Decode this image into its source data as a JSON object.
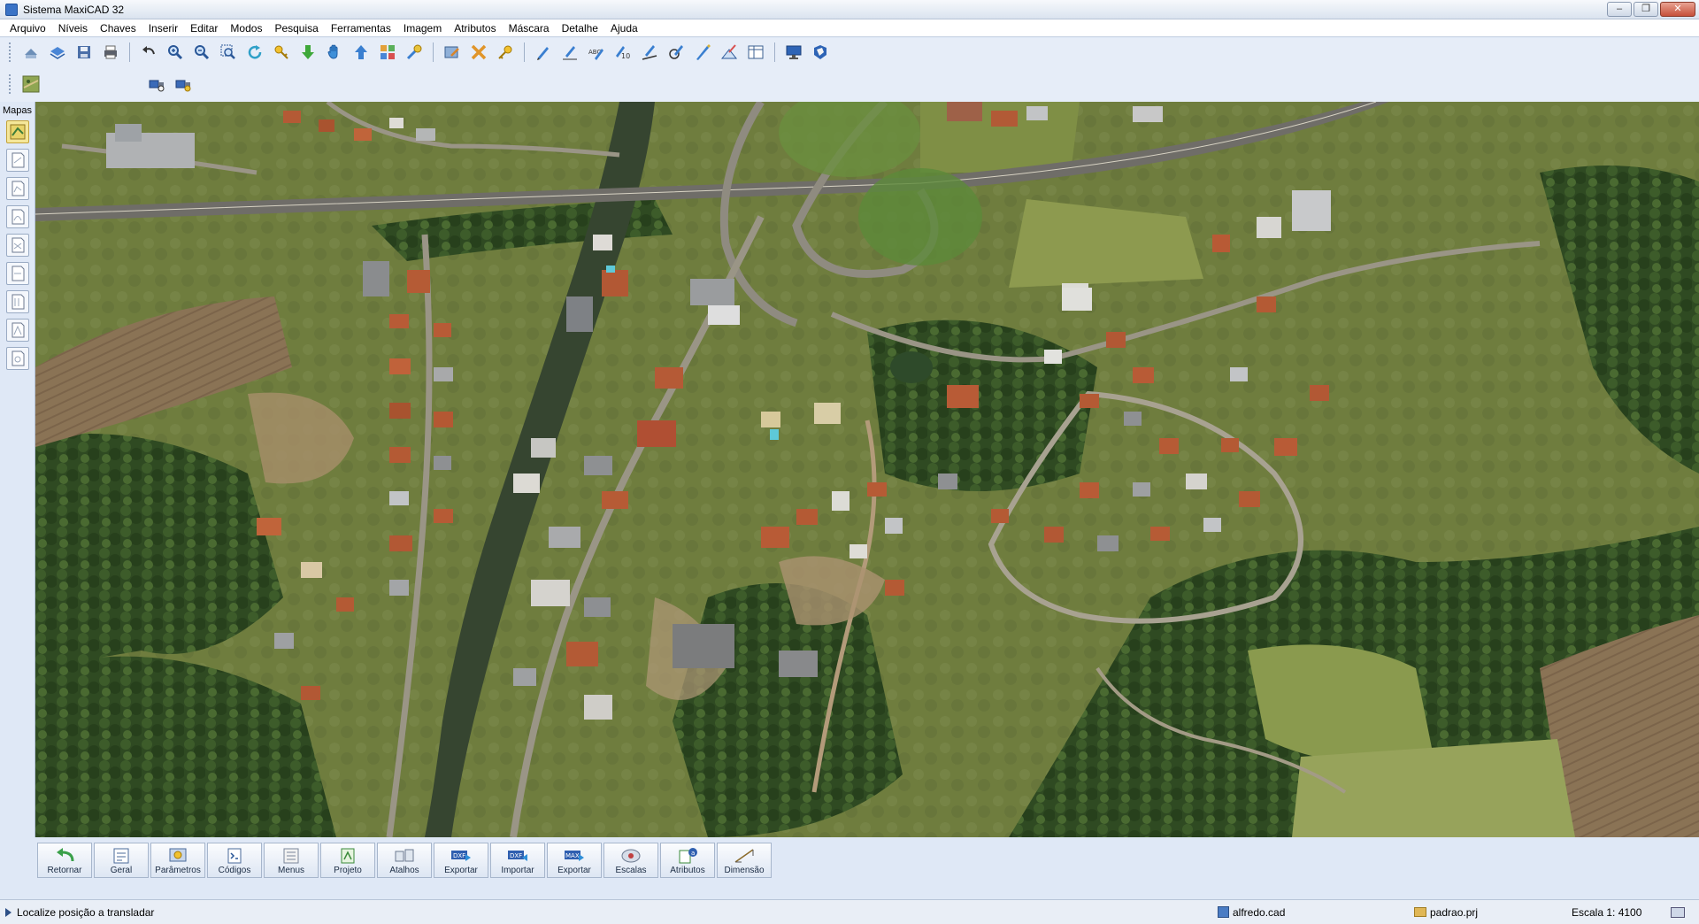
{
  "window": {
    "title": "Sistema MaxiCAD 32"
  },
  "menu": [
    "Arquivo",
    "Níveis",
    "Chaves",
    "Inserir",
    "Editar",
    "Modos",
    "Pesquisa",
    "Ferramentas",
    "Imagem",
    "Atributos",
    "Máscara",
    "Detalhe",
    "Ajuda"
  ],
  "toolbar": {
    "row1_groups": [
      [
        "import-icon",
        "layers-icon",
        "save-icon",
        "print-icon"
      ],
      [
        "undo-icon",
        "zoom-in-icon",
        "zoom-out-icon",
        "zoom-window-icon",
        "regenerate-icon",
        "pan-key-icon",
        "arrow-down-icon",
        "hand-icon",
        "arrow-up-icon",
        "grid-icon",
        "tool-icon"
      ],
      [
        "edit-map-icon",
        "delete-icon",
        "key-icon"
      ],
      [
        "pencil-icon",
        "pencil-text-icon",
        "pencil-abc-icon",
        "pencil-number-icon",
        "pencil-line-icon",
        "pencil-circle-icon",
        "pen-icon",
        "measure-area-icon",
        "table-icon"
      ],
      [
        "monitor-icon",
        "world-icon"
      ]
    ],
    "row2_left": [
      "map-thumbnail-icon"
    ],
    "row2_right": [
      "satellite-icon",
      "satellite-settings-icon"
    ]
  },
  "left_panel": {
    "label": "Mapas",
    "tools": [
      "map-view-icon",
      "map-page-1-icon",
      "map-page-2-icon",
      "map-page-3-icon",
      "map-page-4-icon",
      "map-page-5-icon",
      "map-page-6-icon",
      "map-page-7-icon",
      "map-page-8-icon"
    ]
  },
  "bottom_buttons": [
    {
      "label": "Retornar",
      "icon": "return-arrow-icon"
    },
    {
      "label": "Geral",
      "icon": "general-icon"
    },
    {
      "label": "Parâmetros",
      "icon": "parameters-icon"
    },
    {
      "label": "Códigos",
      "icon": "codes-icon"
    },
    {
      "label": "Menus",
      "icon": "menus-icon"
    },
    {
      "label": "Projeto",
      "icon": "project-icon"
    },
    {
      "label": "Atalhos",
      "icon": "shortcuts-icon"
    },
    {
      "label": "Exportar",
      "icon": "export-dxf-icon",
      "badge": "DXF"
    },
    {
      "label": "Importar",
      "icon": "import-dxf-icon",
      "badge": "DXF"
    },
    {
      "label": "Exportar",
      "icon": "export-max-icon",
      "badge": "MAX"
    },
    {
      "label": "Escalas",
      "icon": "scales-icon"
    },
    {
      "label": "Atributos",
      "icon": "attributes-icon"
    },
    {
      "label": "Dimensão",
      "icon": "dimension-icon"
    }
  ],
  "status": {
    "message": "Localize posição a transladar",
    "file": "alfredo.cad",
    "project": "padrao.prj",
    "scale": "Escala 1: 4100"
  },
  "colors": {
    "accent": "#3a73c6",
    "toolbar_bg": "#e6edf8",
    "panel_bg": "#dfe8f6"
  }
}
